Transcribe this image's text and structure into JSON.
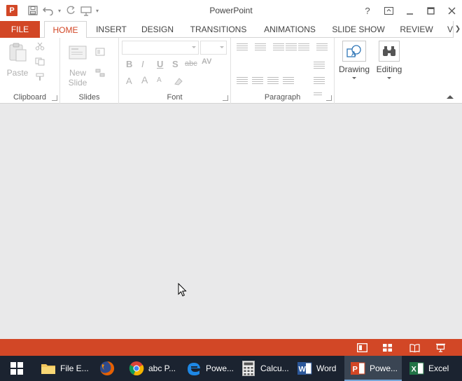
{
  "window": {
    "title": "PowerPoint",
    "app_icon_letter": "P",
    "brand_color": "#d24726"
  },
  "controls": {
    "help": "?",
    "ribbon_options": "ribbon-display-icon",
    "minimize": "minimize-icon",
    "maximize": "maximize-icon",
    "close": "close-icon"
  },
  "tabs": {
    "file": "FILE",
    "home": "HOME",
    "insert": "INSERT",
    "design": "DESIGN",
    "transitions": "TRANSITIONS",
    "animations": "ANIMATIONS",
    "slideshow": "SLIDE SHOW",
    "review": "REVIEW",
    "cut_off": "V"
  },
  "ribbon": {
    "clipboard": {
      "label": "Clipboard",
      "paste": "Paste"
    },
    "slides": {
      "label": "Slides",
      "new_slide_line1": "New",
      "new_slide_line2": "Slide"
    },
    "font": {
      "label": "Font",
      "bold": "B",
      "italic": "I",
      "underline": "U",
      "shadow": "S",
      "strike": "abc",
      "spacing": "AV",
      "font_color": "A",
      "grow": "A",
      "shrink": "A"
    },
    "paragraph": {
      "label": "Paragraph"
    },
    "drawing": {
      "label": "Drawing"
    },
    "editing": {
      "label": "Editing"
    }
  },
  "taskbar": {
    "items": [
      {
        "label": "File E...",
        "icon": "folder-icon"
      },
      {
        "label": "",
        "icon": "firefox-icon"
      },
      {
        "label": "abc P...",
        "icon": "chrome-icon"
      },
      {
        "label": "Powe...",
        "icon": "edge-icon"
      },
      {
        "label": "Calcu...",
        "icon": "calculator-icon"
      },
      {
        "label": "Word",
        "icon": "word-icon"
      },
      {
        "label": "Powe...",
        "icon": "powerpoint-icon"
      },
      {
        "label": "Excel",
        "icon": "excel-icon"
      }
    ]
  }
}
